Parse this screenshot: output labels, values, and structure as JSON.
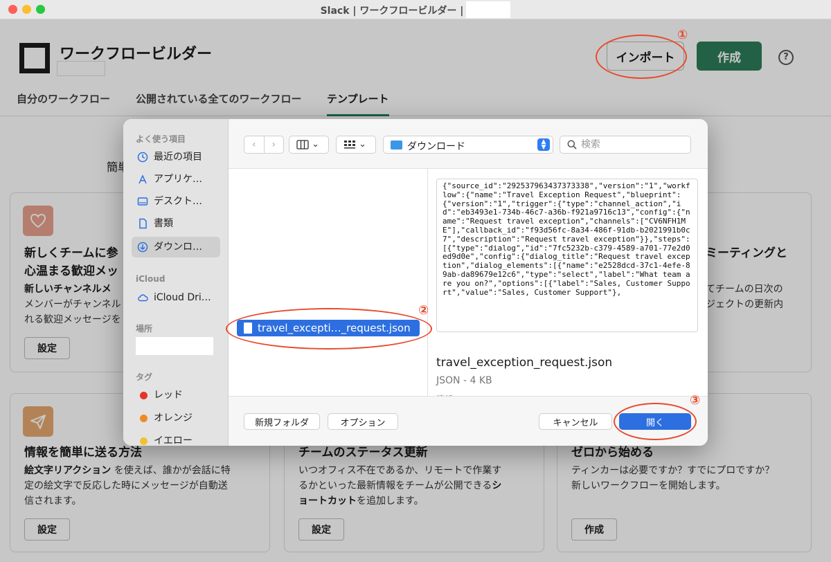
{
  "window": {
    "title": "Slack | ワークフロービルダー |"
  },
  "app": {
    "name": "ワークフロービルダー",
    "import_label": "インポート",
    "create_label": "作成",
    "help_glyph": "?"
  },
  "tabs": [
    {
      "label": "自分のワークフロー"
    },
    {
      "label": "公開されている全てのワークフロー"
    },
    {
      "label": "テンプレート"
    }
  ],
  "section_lead": "簡単",
  "cards": [
    {
      "title": "新しくチームに参",
      "title2": "心温まる歓迎メッ",
      "bold": "新しいチャンネルメ",
      "text1": "メンバーがチャンネル",
      "text2": "れる歓迎メッセージを",
      "button": "設定"
    },
    {
      "title": "ミーティングと",
      "text1": "てチームの日次の",
      "text2": "ジェクトの更新内"
    },
    {
      "title": "情報を簡単に送る方法",
      "bold": "絵文字リアクション",
      "text1": " を使えば、誰かが会話に特",
      "text2": "定の絵文字で反応した時にメッセージが自動送",
      "text3": "信されます。",
      "button": "設定"
    },
    {
      "title": "チームのステータス更新",
      "text1": "いつオフィス不在であるか、リモートで作業す",
      "text2": "るかといった最新情報をチームが公開できる",
      "bold": "シ",
      "bold2": "ョートカット",
      "text3": "を追加します。",
      "button": "設定"
    },
    {
      "title": "ゼロから始める",
      "text1": "ティンカーは必要ですか？すでにプロですか？",
      "text2": "新しいワークフローを開始します。",
      "button": "作成"
    }
  ],
  "dialog": {
    "sidebar": {
      "favorites_header": "よく使う項目",
      "favorites": [
        "最近の項目",
        "アプリケ…",
        "デスクト…",
        "書類",
        "ダウンロ…"
      ],
      "icloud_header": "iCloud",
      "icloud": [
        "iCloud Dri…"
      ],
      "places_header": "場所",
      "tags_header": "タグ",
      "tags": [
        {
          "label": "レッド",
          "color": "#e8322d"
        },
        {
          "label": "オレンジ",
          "color": "#f08a24"
        },
        {
          "label": "イエロー",
          "color": "#f2c12e"
        }
      ]
    },
    "toolbar": {
      "back": "‹",
      "forward": "›",
      "view_chevron": "⌄",
      "location": "ダウンロード",
      "search_placeholder": "検索"
    },
    "selected_file": "travel_excepti…_request.json",
    "preview": {
      "json": "{\"source_id\":\"292537963437373338\",\"version\":\"1\",\"workflow\":{\"name\":\"Travel Exception Request\",\"blueprint\":{\"version\":\"1\",\"trigger\":{\"type\":\"channel_action\",\"id\":\"eb3493e1-734b-46c7-a36b-f921a9716c13\",\"config\":{\"name\":\"Request travel exception\",\"channels\":[\"CV6NFH1ME\"],\"callback_id\":\"f93d56fc-8a34-486f-91db-b2021991b0c7\",\"description\":\"Request travel exception\"}},\"steps\":[{\"type\":\"dialog\",\"id\":\"7fc5232b-c379-4589-a701-77e2d0ed9d0e\",\"config\":{\"dialog_title\":\"Request travel exception\",\"dialog_elements\":[{\"name\":\"e2528dcd-37c1-4efe-89ab-da89679e12c6\",\"type\":\"select\",\"label\":\"What team are you on?\",\"options\":[{\"label\":\"Sales, Customer Support\",\"value\":\"Sales, Customer Support\"},",
      "filename": "travel_exception_request.json",
      "meta": "JSON - 4 KB",
      "more": "情報"
    },
    "footer": {
      "new_folder": "新規フォルダ",
      "options": "オプション",
      "cancel": "キャンセル",
      "open": "開く"
    }
  },
  "annotations": [
    "①",
    "②",
    "③"
  ]
}
